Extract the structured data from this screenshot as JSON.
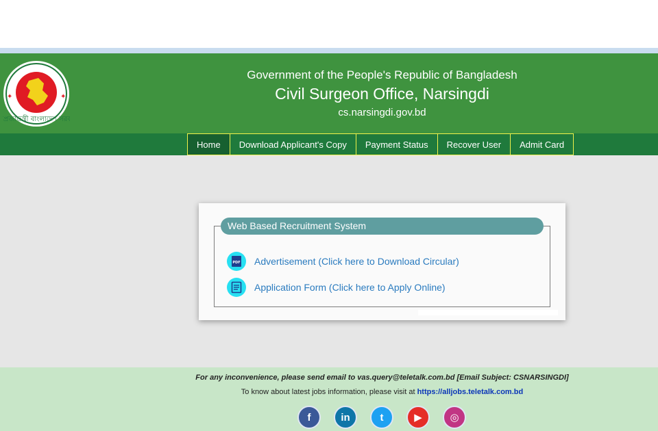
{
  "header": {
    "gov_line": "Government of the People's Republic of Bangladesh",
    "office_line": "Civil Surgeon Office, Narsingdi",
    "domain_line": "cs.narsingdi.gov.bd",
    "logo_text": "গণপ্রজাতন্ত্রী বাংলাদেশ সরকার"
  },
  "nav": {
    "items": [
      "Home",
      "Download Applicant's Copy",
      "Payment Status",
      "Recover User",
      "Admit Card"
    ]
  },
  "card": {
    "legend": "Web Based Recruitment System",
    "links": [
      {
        "label": "Advertisement (Click here to Download Circular)",
        "icon": "pdf-icon"
      },
      {
        "label": "Application Form (Click here to Apply Online)",
        "icon": "form-icon"
      }
    ]
  },
  "footer": {
    "line1": "For any inconvenience, please send email to vas.query@teletalk.com.bd [Email Subject: CSNARSINGDI]",
    "line2_prefix": "To know about latest jobs information, please visit at",
    "line2_link": "https://alljobs.teletalk.com.bd",
    "socials": [
      {
        "name": "facebook",
        "glyph": "f",
        "color": "#3b5998"
      },
      {
        "name": "linkedin",
        "glyph": "in",
        "color": "#0e76a8"
      },
      {
        "name": "twitter",
        "glyph": "t",
        "color": "#1da1f2"
      },
      {
        "name": "youtube",
        "glyph": "▶",
        "color": "#e52d27"
      },
      {
        "name": "instagram",
        "glyph": "◎",
        "color": "#c13584"
      }
    ]
  },
  "colors": {
    "header_green": "#3f933f",
    "nav_green": "#1f7a3c",
    "nav_border": "#f2f24a",
    "legend_teal": "#5f9ea0",
    "link_blue": "#2a7bbf",
    "footer_green": "#c8e6c8"
  }
}
